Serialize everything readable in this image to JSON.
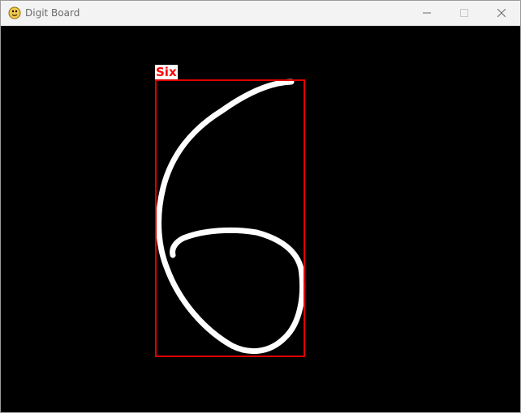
{
  "window": {
    "title": "Digit Board",
    "app_icon": "python-snake-icon",
    "controls": [
      "minimize-icon",
      "maximize-icon",
      "close-icon"
    ]
  },
  "canvas": {
    "background": "#000000",
    "stroke_color": "#ffffff",
    "prediction": {
      "label": "Six",
      "label_color": "#ff0000",
      "label_background": "#ffffff",
      "box_color": "#e00000"
    }
  }
}
